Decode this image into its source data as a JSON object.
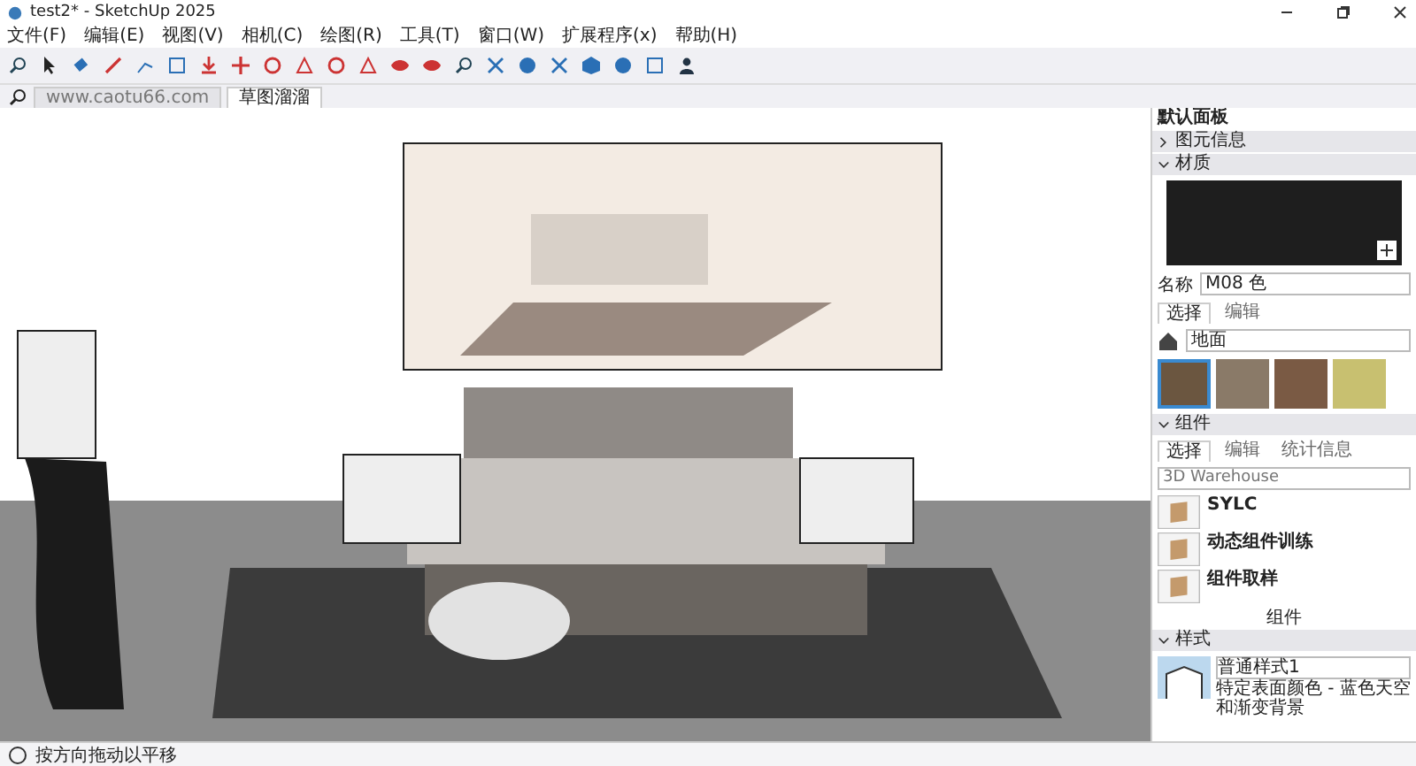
{
  "window": {
    "title": "test2* - SketchUp 2025"
  },
  "menu": [
    "文件(F)",
    "编辑(E)",
    "视图(V)",
    "相机(C)",
    "绘图(R)",
    "工具(T)",
    "窗口(W)",
    "扩展程序(x)",
    "帮助(H)"
  ],
  "scene_tabs": [
    {
      "label": "www.caotu66.com",
      "selected": false
    },
    {
      "label": "草图溜溜",
      "selected": true
    }
  ],
  "tray": {
    "title": "默认面板",
    "entity_info": {
      "title": "图元信息",
      "expanded": false
    },
    "materials": {
      "title": "材质",
      "expanded": true,
      "name_label": "名称",
      "name_value": "M08 色",
      "tabs": [
        {
          "label": "选择",
          "selected": true
        },
        {
          "label": "编辑",
          "selected": false
        }
      ],
      "library": "地面",
      "swatches": [
        {
          "color": "#6b5640",
          "selected": true
        },
        {
          "color": "#8a7a68",
          "selected": false
        },
        {
          "color": "#7a5a44",
          "selected": false
        },
        {
          "color": "#c8c070",
          "selected": false
        }
      ]
    },
    "components": {
      "title": "组件",
      "expanded": true,
      "tabs": [
        {
          "label": "选择",
          "selected": true
        },
        {
          "label": "编辑",
          "selected": false
        },
        {
          "label": "统计信息",
          "selected": false
        }
      ],
      "search_placeholder": "3D Warehouse",
      "items": [
        {
          "name": "SYLC"
        },
        {
          "name": "动态组件训练"
        },
        {
          "name": "组件取样"
        }
      ],
      "footer": "组件"
    },
    "styles": {
      "title": "样式",
      "expanded": true,
      "name": "普通样式1",
      "description": "特定表面颜色 - 蓝色天空和渐变背景"
    }
  },
  "status_bar": {
    "message": "按方向拖动以平移"
  }
}
